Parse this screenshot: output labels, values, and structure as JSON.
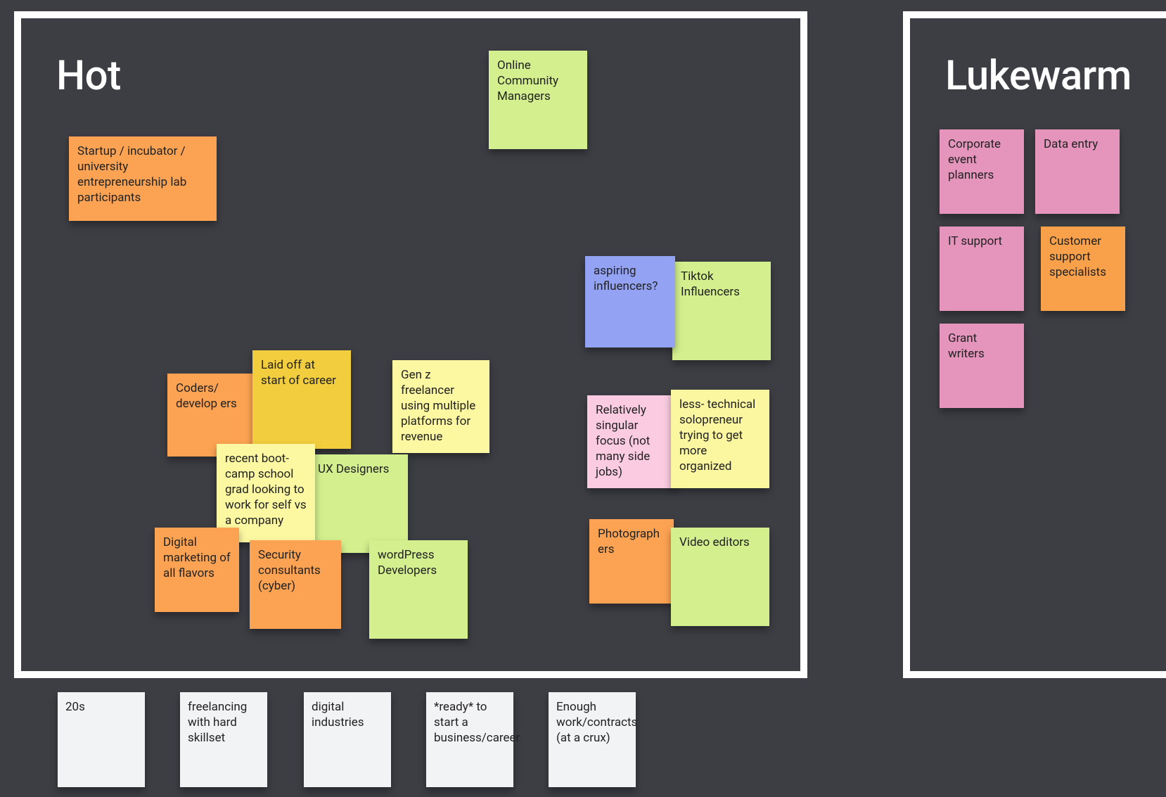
{
  "frames": {
    "hot": {
      "title": "Hot"
    },
    "lukewarm": {
      "title": "Lukewarm"
    }
  },
  "hot": {
    "startup": "Startup / incubator / university entrepreneurship lab participants",
    "online_comm": "Online Community Managers",
    "aspiring_inf": "aspiring influencers?",
    "tiktok": "Tiktok Influencers",
    "coders": "Coders/ develop ers",
    "laid_off": "Laid off at start of career",
    "genz": "Gen z freelancer using multiple platforms for revenue",
    "singular_focus": "Relatively singular focus (not many side jobs)",
    "less_tech": "less- technical solopreneur trying to get more organized",
    "bootcamp": "recent boot-camp school grad looking to work for self vs a company",
    "ux": "UX Designers",
    "dig_marketing": "Digital marketing of all flavors",
    "security": "Security consultants (cyber)",
    "wordpress": "wordPress Developers",
    "photographers": "Photograph ers",
    "video_editors": "Video editors"
  },
  "lukewarm": {
    "corp_event": "Corporate event planners",
    "data_entry": "Data entry",
    "it_support": "IT support",
    "cust_support": "Customer support specialists",
    "grant": "Grant writers"
  },
  "tray": {
    "t1": "20s",
    "t2": "freelancing with hard skillset",
    "t3": "digital industries",
    "t4": "*ready* to start a business/career",
    "t5": "Enough work/contracts (at a crux)"
  }
}
